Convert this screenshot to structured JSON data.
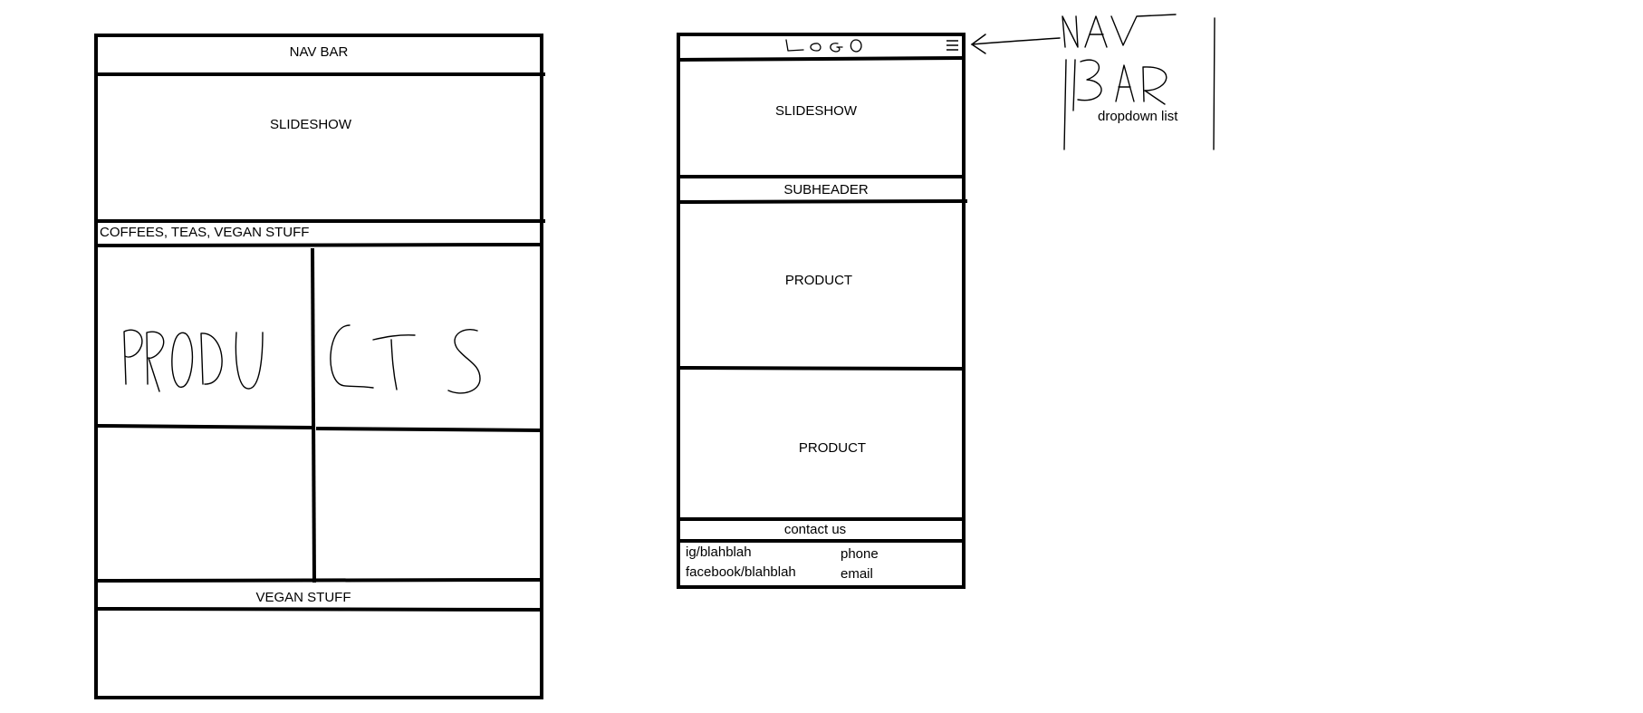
{
  "desktop": {
    "nav_bar": "NAV BAR",
    "slideshow": "SLIDESHOW",
    "categories": "COFFEES, TEAS, VEGAN STUFF",
    "products_scribble": "PRODUCTS",
    "vegan_stuff": "VEGAN STUFF"
  },
  "mobile": {
    "logo_scribble": "Logo",
    "menu_icon": "hamburger-menu-icon",
    "slideshow": "SLIDESHOW",
    "subheader": "SUBHEADER",
    "product_1": "PRODUCT",
    "product_2": "PRODUCT",
    "contact_us": "contact us",
    "footer": {
      "ig": "ig/blahblah",
      "facebook": "facebook/blahblah",
      "phone": "phone",
      "email": "email"
    }
  },
  "annotation": {
    "title_scribble": "NAV BAR",
    "note": "dropdown list"
  }
}
